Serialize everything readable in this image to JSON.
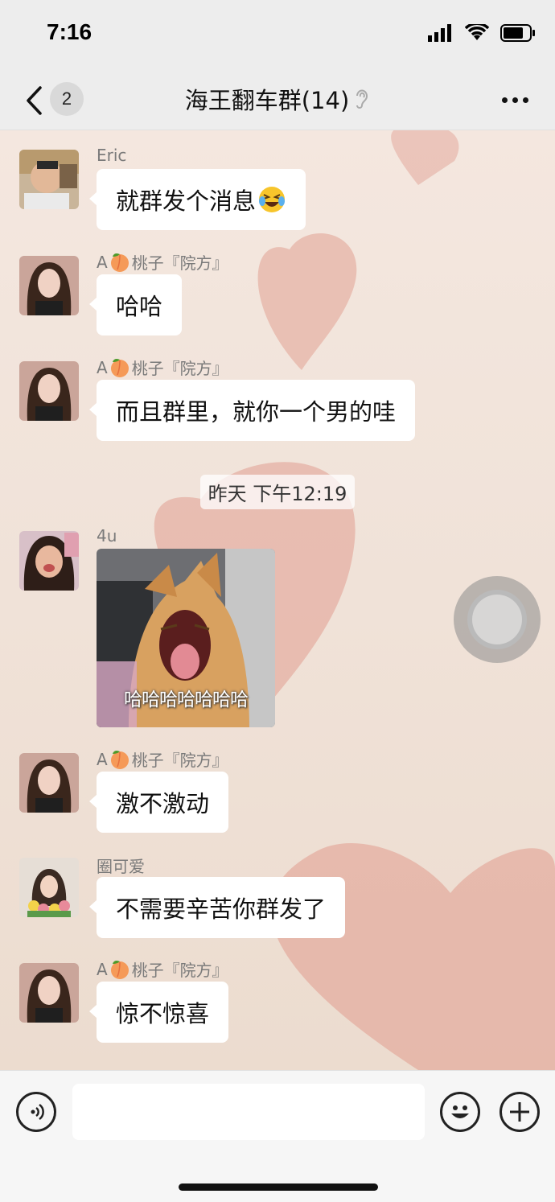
{
  "status_bar": {
    "time": "7:16"
  },
  "nav": {
    "unread_count": "2",
    "title": "海王翻车群(14)"
  },
  "messages": [
    {
      "sender": "Eric",
      "text": "就群发个消息"
    },
    {
      "sender_prefix": "A",
      "sender_name": "桃子『院方』",
      "text": "哈哈"
    },
    {
      "sender_prefix": "A",
      "sender_name": "桃子『院方』",
      "text": "而且群里，就你一个男的哇"
    },
    {
      "sender": "4u",
      "sticker_caption": "哈哈哈哈哈哈哈"
    },
    {
      "sender_prefix": "A",
      "sender_name": "桃子『院方』",
      "text": "激不激动"
    },
    {
      "sender": "圈可爱",
      "text": "不需要辛苦你群发了"
    },
    {
      "sender_prefix": "A",
      "sender_name": "桃子『院方』",
      "text": "惊不惊喜"
    }
  ],
  "timestamp": "昨天 下午12:19",
  "colors": {
    "nav_bg": "#ededed",
    "chat_bg": "#efe3da",
    "heart": "#e3a79a",
    "bubble": "#ffffff"
  },
  "icons": [
    "signal-icon",
    "wifi-icon",
    "battery-icon",
    "back-chevron-icon",
    "ear-icon",
    "more-icon",
    "voice-icon",
    "emoji-icon",
    "plus-icon",
    "peach-emoji-icon",
    "laughing-emoji-icon"
  ]
}
